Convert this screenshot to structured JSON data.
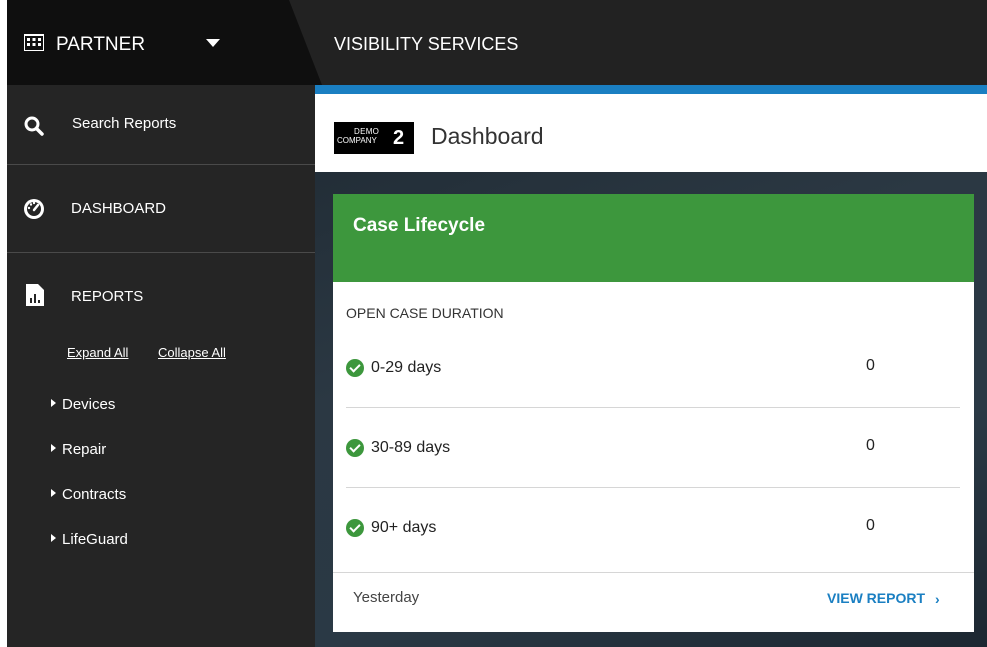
{
  "topbar": {
    "partner_label": "PARTNER",
    "service_label": "VISIBILITY SERVICES"
  },
  "sidebar": {
    "search_label": "Search Reports",
    "dashboard_label": "DASHBOARD",
    "reports_label": "REPORTS",
    "expand_all": "Expand All",
    "collapse_all": "Collapse All",
    "tree": [
      "Devices",
      "Repair",
      "Contracts",
      "LifeGuard"
    ]
  },
  "header": {
    "logo_line1": "DEMO",
    "logo_line2": "COMPANY",
    "logo_number": "2",
    "title": "Dashboard"
  },
  "card": {
    "title": "Case Lifecycle",
    "subtitle": "OPEN CASE DURATION",
    "rows": [
      {
        "label": "0-29 days",
        "value": "0"
      },
      {
        "label": "30-89 days",
        "value": "0"
      },
      {
        "label": "90+ days",
        "value": "0"
      }
    ],
    "footer_time": "Yesterday",
    "view_report": "VIEW REPORT",
    "view_report_chevron": "›"
  },
  "colors": {
    "accent_blue": "#1a7fc2",
    "card_green": "#3d973d",
    "sidebar_bg": "#252525",
    "topbar_bg": "#222222"
  },
  "icons": {
    "partner": "building-icon",
    "partner_caret": "caret-down-icon",
    "search": "search-icon",
    "dashboard": "speedometer-icon",
    "reports": "report-file-icon",
    "tree_arrow": "triangle-right-icon",
    "row_status": "check-circle-icon",
    "view_report": "chevron-right-icon"
  }
}
